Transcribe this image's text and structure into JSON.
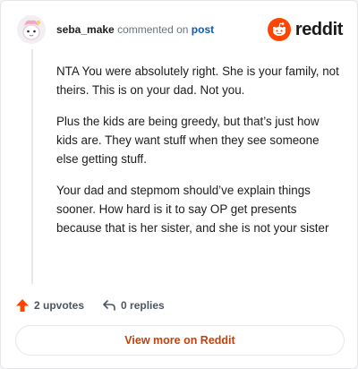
{
  "comment": {
    "username": "seba_make",
    "action_text": "commented on",
    "post_link": "post",
    "paragraphs": [
      "NTA You were absolutely right. She is your family, not theirs. This is on your dad. Not you.",
      "Plus the kids are being greedy, but that’s just how kids are. They want stuff when they see someone else getting stuff.",
      "Your dad and stepmom should’ve explain things sooner. How hard is it to say OP get presents because that is her sister, and she is not your sister"
    ]
  },
  "brand": {
    "name": "reddit",
    "color": "#ff4500"
  },
  "actions": {
    "upvotes_label": "2 upvotes",
    "replies_label": "0 replies"
  },
  "footer": {
    "view_more_label": "View more on Reddit",
    "color": "#c2410c"
  }
}
